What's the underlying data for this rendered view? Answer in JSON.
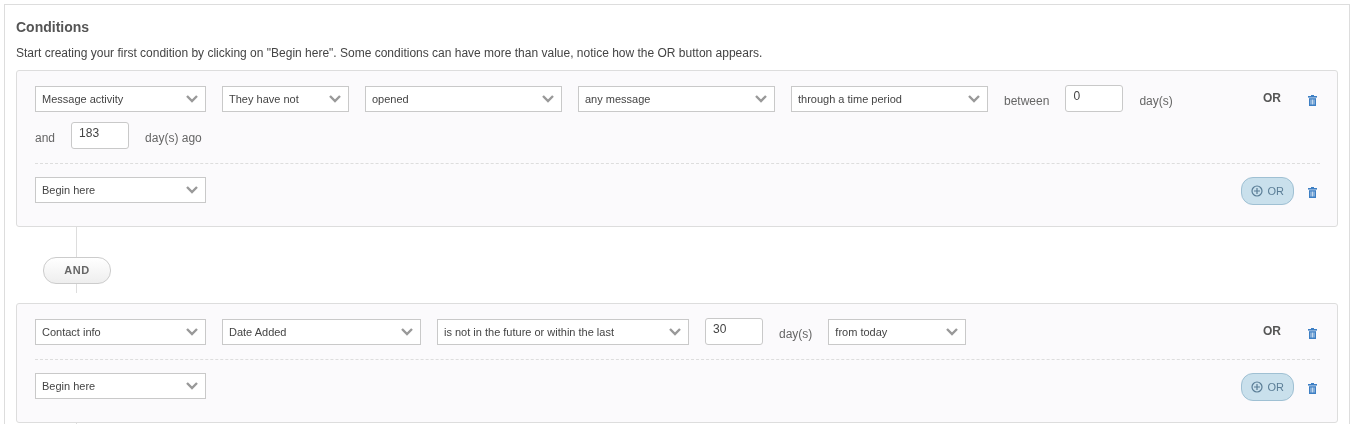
{
  "title": "Conditions",
  "description": "Start creating your first condition by clicking on \"Begin here\". Some conditions can have more than value, notice how the OR button appears.",
  "groups": [
    {
      "conditions": [
        {
          "items": [
            {
              "kind": "select",
              "value": "Message activity"
            },
            {
              "kind": "select",
              "value": "They have not"
            },
            {
              "kind": "select",
              "value": "opened"
            },
            {
              "kind": "select",
              "value": "any message"
            },
            {
              "kind": "select",
              "value": "through a time period"
            },
            {
              "kind": "text",
              "value": "between"
            },
            {
              "kind": "input",
              "value": "0"
            },
            {
              "kind": "text",
              "value": "day(s)"
            },
            {
              "kind": "text",
              "value": "and"
            },
            {
              "kind": "input",
              "value": "183"
            },
            {
              "kind": "text",
              "value": "day(s) ago"
            }
          ],
          "or_label": "OR"
        },
        {
          "items": [
            {
              "kind": "select",
              "value": "Begin here"
            }
          ],
          "or_button": "OR"
        }
      ]
    },
    {
      "connector": "AND",
      "conditions": [
        {
          "items": [
            {
              "kind": "select",
              "value": "Contact info"
            },
            {
              "kind": "select",
              "value": "Date Added"
            },
            {
              "kind": "select",
              "value": "is not in the future or within the last"
            },
            {
              "kind": "input",
              "value": "30"
            },
            {
              "kind": "text",
              "value": "day(s)"
            },
            {
              "kind": "select",
              "value": "from today"
            }
          ],
          "or_label": "OR"
        },
        {
          "items": [
            {
              "kind": "select",
              "value": "Begin here"
            }
          ],
          "or_button": "OR"
        }
      ]
    }
  ]
}
